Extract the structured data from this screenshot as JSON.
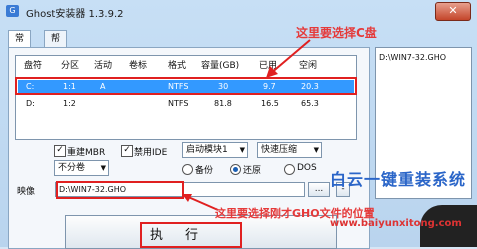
{
  "window": {
    "title": "Ghost安装器 1.3.9.2",
    "close": "✕"
  },
  "tabs": [
    {
      "label": "常规"
    },
    {
      "label": "帮助"
    }
  ],
  "table": {
    "headers": [
      "盘符",
      "分区",
      "活动",
      "卷标",
      "格式",
      "容量(GB)",
      "已用",
      "空闲"
    ],
    "rows": [
      [
        "C:",
        "1:1",
        "A",
        "",
        "NTFS",
        "30",
        "9.7",
        "20.3"
      ],
      [
        "D:",
        "1:2",
        "",
        "",
        "NTFS",
        "81.8",
        "16.5",
        "65.3"
      ]
    ],
    "selected_row": 0
  },
  "options": {
    "rebuild_mbr": {
      "label": "重建MBR",
      "checked": true
    },
    "disable_ide": {
      "label": "禁用IDE",
      "checked": true
    },
    "boot_module": "启动模块1",
    "compress": "快速压缩",
    "split": "不分卷",
    "mode_backup": "备份",
    "mode_restore": "还原",
    "mode_dos": "DOS",
    "selected_mode": "还原"
  },
  "image": {
    "label": "映像",
    "path": "D:\\WIN7-32.GHO",
    "browse": "...",
    "minus": "-"
  },
  "execute_label": "执行",
  "right_list": [
    "D:\\WIN7-32.GHO"
  ],
  "annotations": {
    "choose_c": "这里要选择C盘",
    "choose_image": "这里要选择刚才GHO文件的位置"
  },
  "watermark": {
    "brand": "白云一键重装系统",
    "url": "www.baiyunxitong.com"
  },
  "colors": {
    "accent": "#e02020",
    "selection": "#3399ff"
  }
}
